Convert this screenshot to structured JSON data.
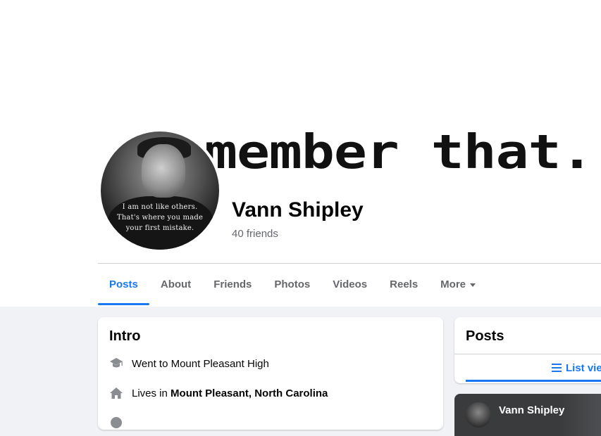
{
  "cover": {
    "text": "member that."
  },
  "profile": {
    "avatar_quote": [
      "I am not like others.",
      "That's where you made",
      "your first mistake."
    ],
    "name": "Vann Shipley",
    "friends": "40 friends"
  },
  "tabs": [
    {
      "label": "Posts",
      "active": true
    },
    {
      "label": "About"
    },
    {
      "label": "Friends"
    },
    {
      "label": "Photos"
    },
    {
      "label": "Videos"
    },
    {
      "label": "Reels"
    },
    {
      "label": "More"
    }
  ],
  "intro": {
    "title": "Intro",
    "items": [
      {
        "icon": "graduation-cap-icon",
        "prefix": "Went to Mount Pleasant High",
        "bold": ""
      },
      {
        "icon": "home-icon",
        "prefix": "Lives in ",
        "bold": "Mount Pleasant, North Carolina"
      }
    ]
  },
  "posts": {
    "title": "Posts",
    "list_view": "List view",
    "preview_name": "Vann Shipley"
  },
  "colors": {
    "accent": "#1877f2",
    "muted": "#65676b",
    "background": "#f0f2f5"
  }
}
